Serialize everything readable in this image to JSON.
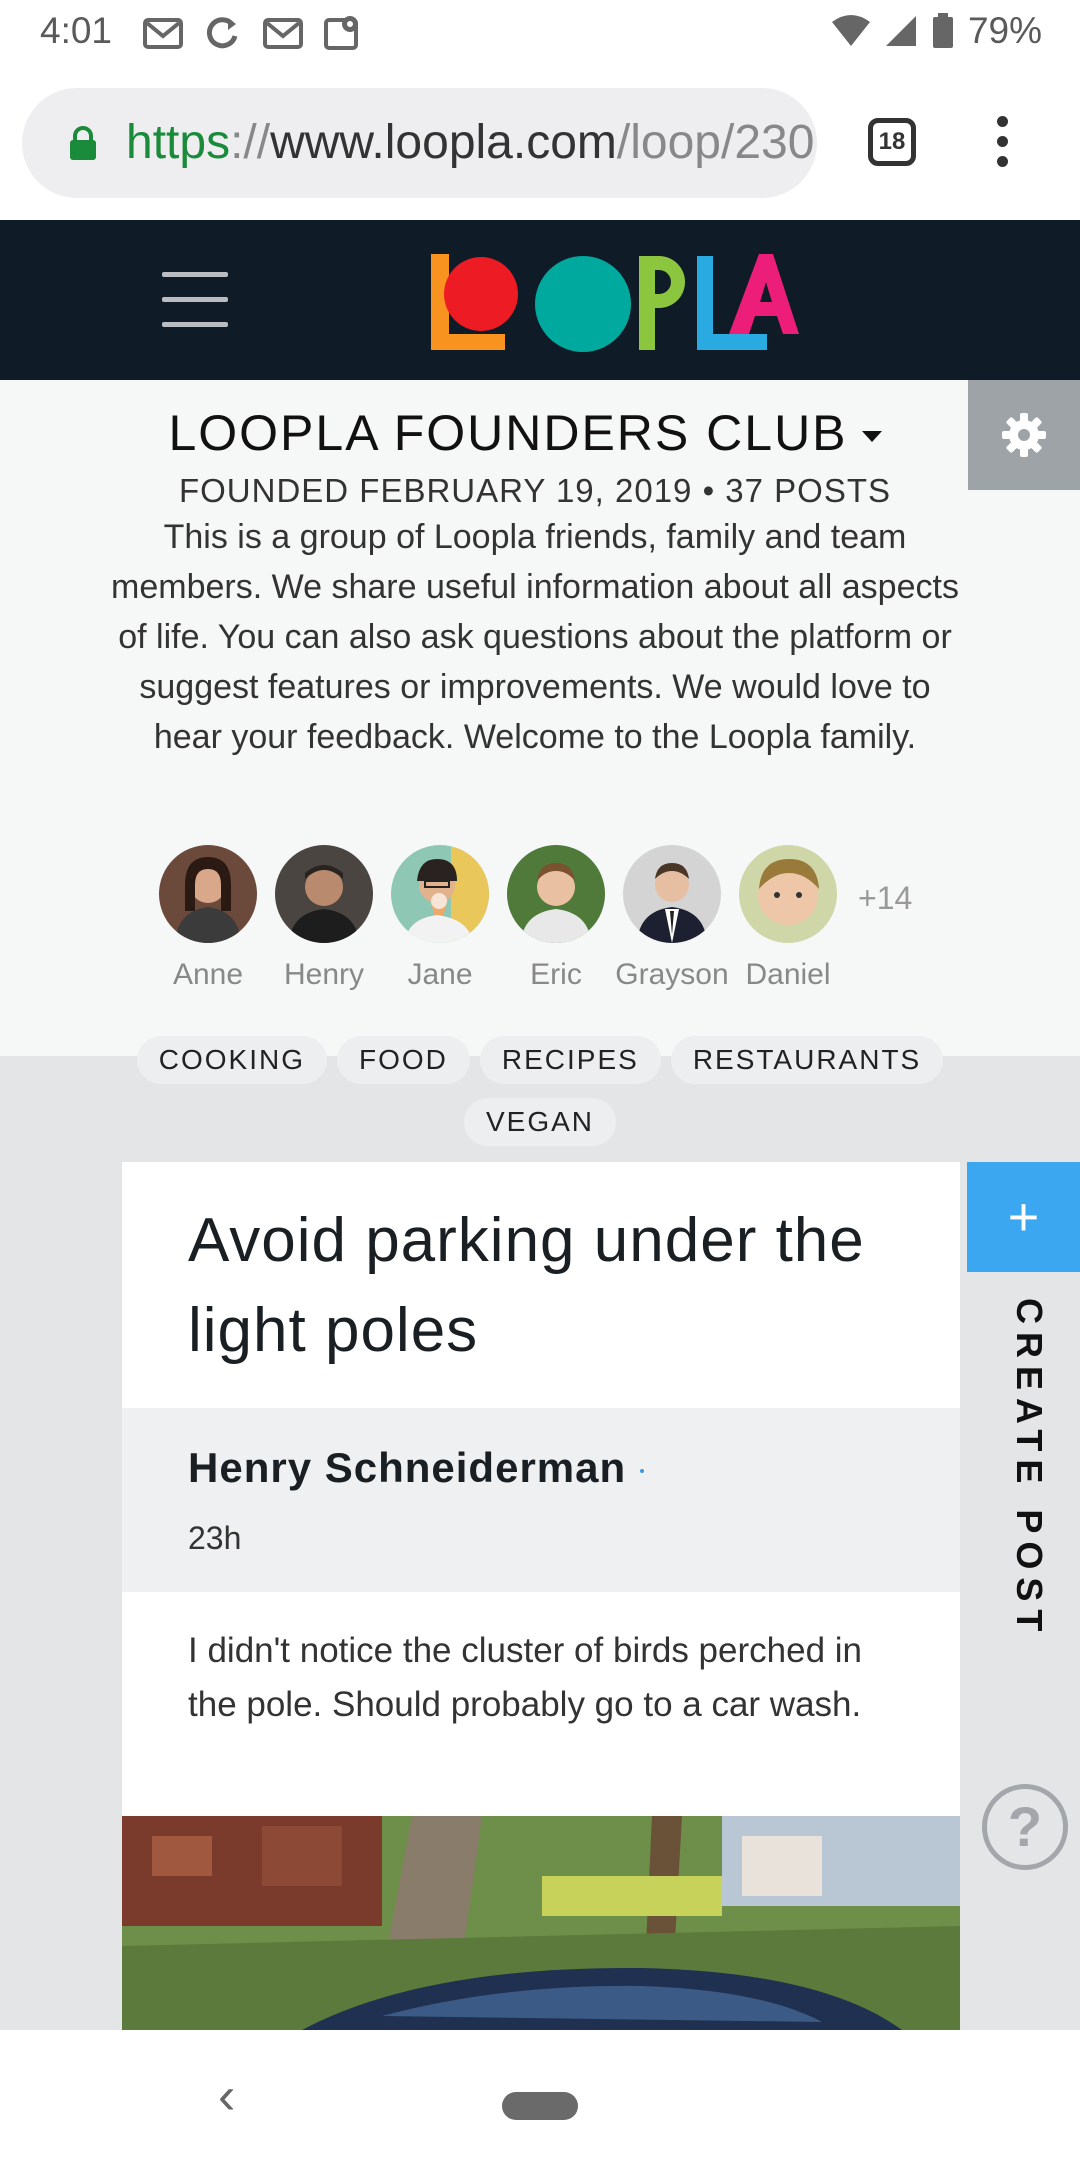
{
  "status_bar": {
    "time": "4:01",
    "battery_percent": "79%",
    "icons": [
      "gmail-icon",
      "sync-icon",
      "gmail-icon",
      "maps-icon",
      "wifi-icon",
      "signal-icon",
      "battery-icon"
    ]
  },
  "browser": {
    "url_scheme": "https",
    "url_sep": "://",
    "url_host": "www.loopla.com",
    "url_path": "/loop/230",
    "tab_count": "18"
  },
  "header": {
    "logo_letters": [
      "L",
      "O",
      "O",
      "P",
      "L",
      "A"
    ],
    "colors": {
      "bg": "#0f1c28",
      "orange": "#f7931e",
      "red": "#ed1c24",
      "teal": "#00a99d",
      "green": "#8cc63f",
      "blue": "#29abe2",
      "pink": "#ed1e79"
    }
  },
  "club": {
    "title": "LOOPLA FOUNDERS CLUB",
    "meta": "FOUNDED FEBRUARY 19, 2019 • 37 POSTS",
    "description": "This is a group of Loopla friends, family and team members. We share useful information about all aspects of life. You can also ask questions about the platform or suggest features or improvements. We would love to hear your feedback. Welcome to the Loopla family.",
    "members": [
      {
        "name": "Anne"
      },
      {
        "name": "Henry"
      },
      {
        "name": "Jane"
      },
      {
        "name": "Eric"
      },
      {
        "name": "Grayson"
      },
      {
        "name": "Daniel"
      }
    ],
    "more_members": "+14"
  },
  "tags": [
    "COOKING",
    "FOOD",
    "RECIPES",
    "RESTAURANTS",
    "VEGAN"
  ],
  "post": {
    "title": "Avoid parking under the light poles",
    "author": "Henry Schneiderman",
    "time": "23h",
    "body": "I didn't notice the cluster of birds perched in the pole. Should probably go to a car wash."
  },
  "actions": {
    "create_post_symbol": "+",
    "create_post_label": "CREATE POST",
    "help_symbol": "?"
  },
  "nav": {
    "back_symbol": "‹"
  }
}
